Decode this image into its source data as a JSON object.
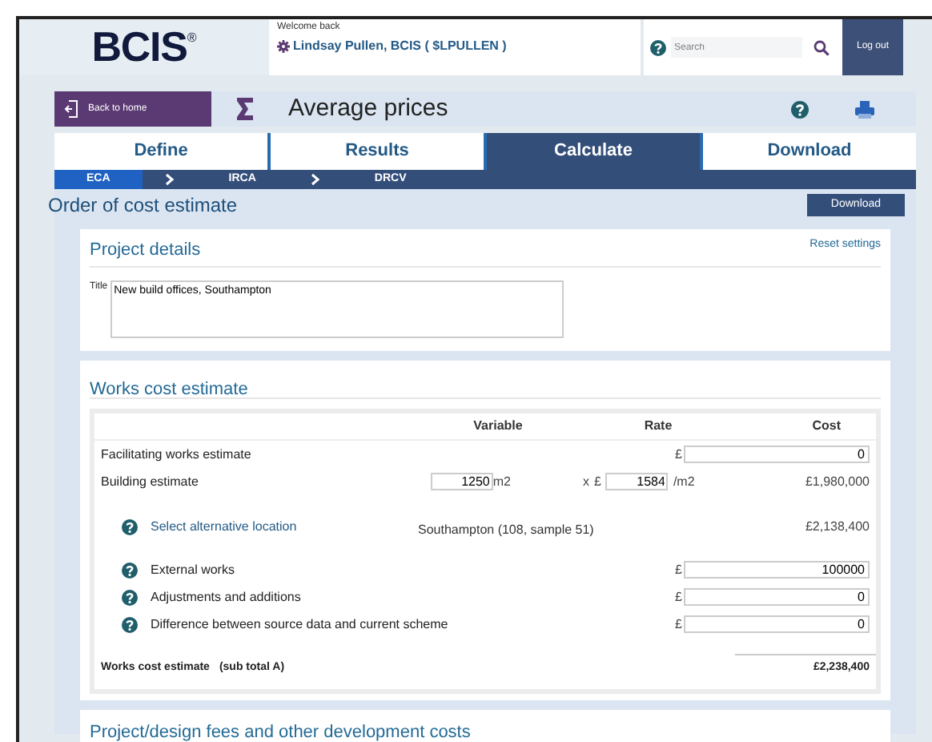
{
  "header": {
    "logo": "BCIS",
    "logo_mark": "®",
    "welcome": "Welcome back",
    "user": "Lindsay Pullen, BCIS ( $LPULLEN )",
    "search_placeholder": "Search",
    "logout": "Log out"
  },
  "toolbar": {
    "back": "Back to home",
    "title": "Average prices"
  },
  "steps": [
    {
      "label": "Define",
      "selected": false
    },
    {
      "label": "Results",
      "selected": false
    },
    {
      "label": "Calculate",
      "selected": true
    },
    {
      "label": "Download",
      "selected": false
    }
  ],
  "substeps": [
    {
      "label": "ECA",
      "selected": true
    },
    {
      "label": "IRCA",
      "selected": false
    },
    {
      "label": "DRCV",
      "selected": false
    }
  ],
  "page": {
    "title": "Order of cost estimate",
    "download": "Download"
  },
  "project_details": {
    "title": "Project details",
    "reset": "Reset settings",
    "field_label": "Title",
    "value": "New build offices, Southampton"
  },
  "works": {
    "title": "Works cost estimate",
    "columns": [
      "Variable",
      "Rate",
      "Cost"
    ],
    "rows": [
      {
        "kind": "input",
        "help": false,
        "label": "Facilitating works estimate",
        "currency": "£",
        "value": "0"
      },
      {
        "kind": "calc",
        "help": false,
        "label": "Building estimate",
        "variable": "1250",
        "variable_unit": "m2",
        "operator": "x",
        "currency": "£",
        "rate": "1584",
        "rate_unit": "/m2",
        "cost": "£1,980,000"
      },
      {
        "kind": "link",
        "help": true,
        "label": "Select alternative location",
        "variable": "Southampton (108, sample 51)",
        "cost": "£2,138,400"
      },
      {
        "kind": "input",
        "help": true,
        "label": "External works",
        "currency": "£",
        "value": "100000"
      },
      {
        "kind": "input",
        "help": true,
        "label": "Adjustments and additions",
        "currency": "£",
        "value": "0"
      },
      {
        "kind": "input",
        "help": true,
        "label": "Difference between source data and current scheme",
        "currency": "£",
        "value": "0"
      }
    ],
    "total": {
      "label": "Works cost estimate",
      "note": "(sub total A)",
      "value": "£2,238,400"
    }
  },
  "next_section": {
    "title": "Project/design fees and other development costs"
  }
}
